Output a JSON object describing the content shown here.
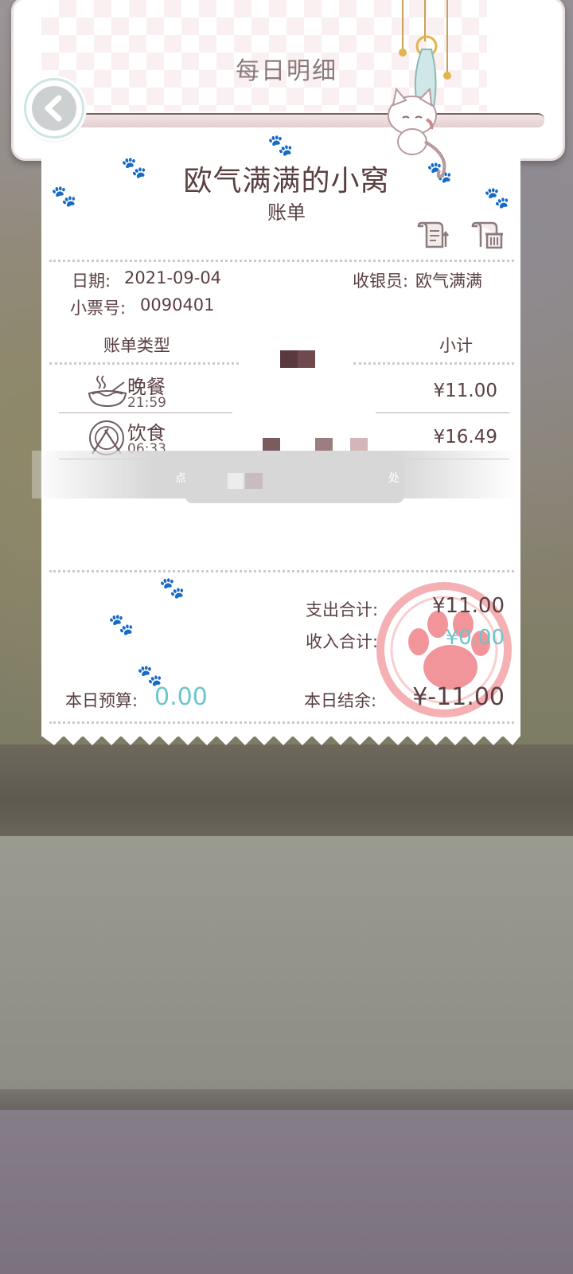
{
  "header": {
    "title": "每日明细"
  },
  "receipt": {
    "shop_name": "欧气满满的小窝",
    "bill_label": "账单",
    "date_label": "日期:",
    "date_value": "2021-09-04",
    "cashier_label": "收银员:",
    "cashier_value": "欧气满满",
    "ticket_label": "小票号:",
    "ticket_value": "0090401",
    "col_type": "账单类型",
    "col_subtotal": "小计",
    "items": [
      {
        "name": "晚餐",
        "time": "21:59",
        "amount": "¥11.00",
        "icon": "noodle-bowl-icon"
      },
      {
        "name": "饮食",
        "time": "06:33",
        "amount": "¥16.49",
        "icon": "plate-utensils-icon"
      }
    ],
    "hint_left": "点",
    "hint_right": "处",
    "expense_total_label": "支出合计:",
    "expense_total_value": "¥11.00",
    "income_total_label": "收入合计:",
    "income_total_value": "¥0.00",
    "budget_label": "本日预算:",
    "budget_value": "0.00",
    "balance_label": "本日结余:",
    "balance_value": "¥-11.00"
  },
  "colors": {
    "text": "#5a3f42",
    "teal": "#6bc6c9",
    "stamp": "#f08a8f"
  },
  "icons": [
    "back-arrow-icon",
    "edit-receipt-icon",
    "delete-receipt-icon",
    "paw-stamp-icon",
    "cat-decoration-icon"
  ]
}
